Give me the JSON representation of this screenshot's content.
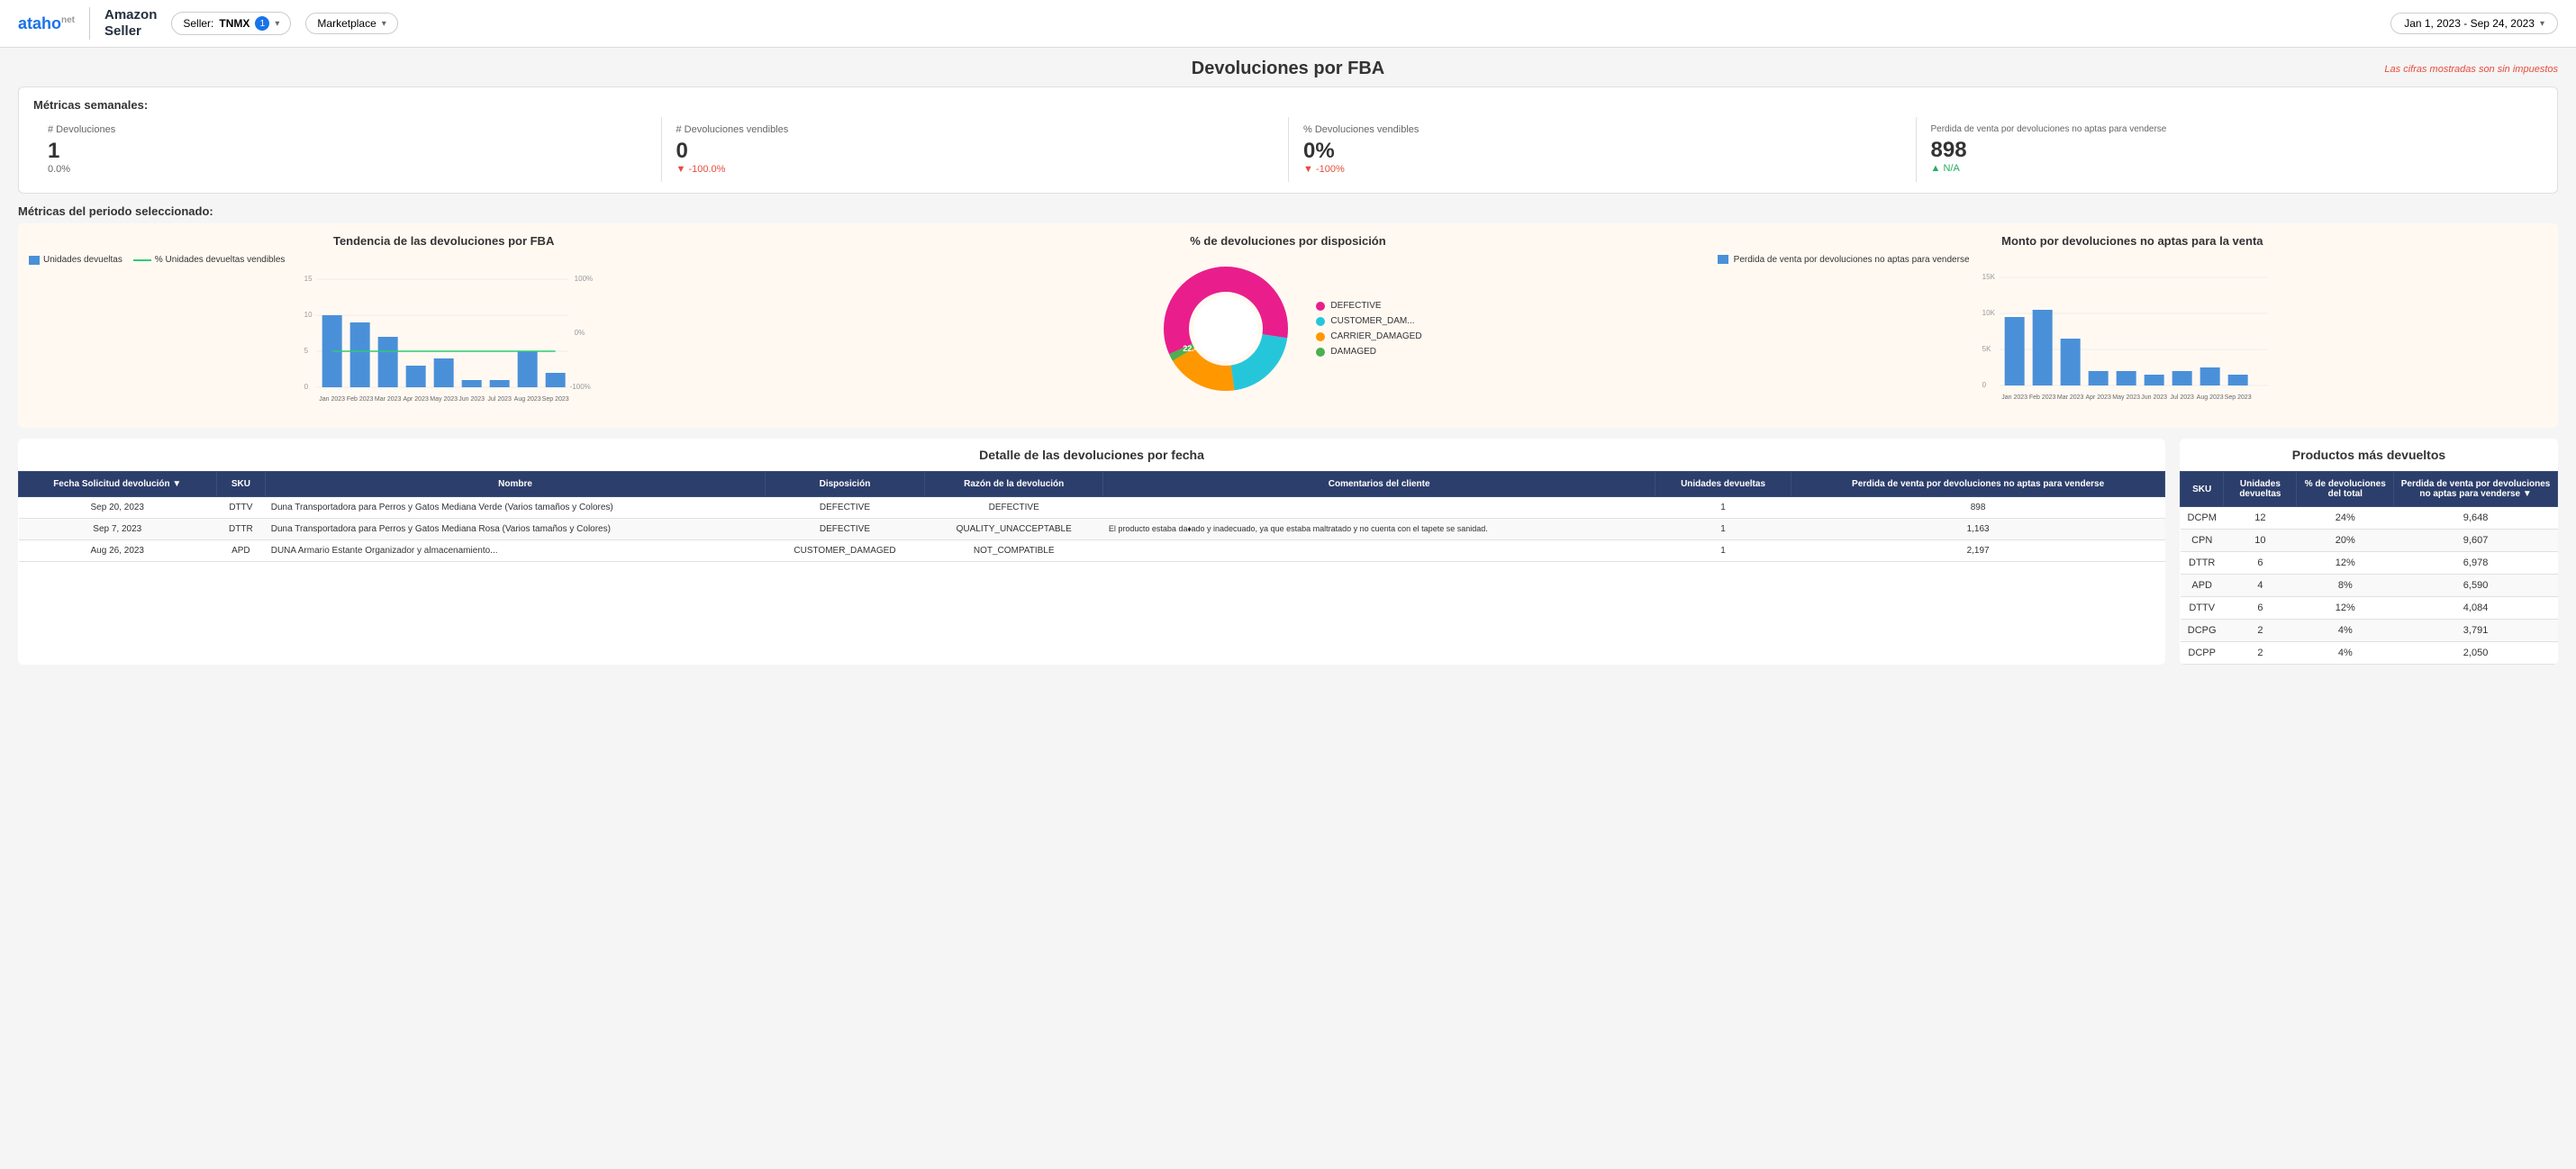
{
  "header": {
    "logo_main": "ataho",
    "logo_sup": "net",
    "brand_line1": "Amazon",
    "brand_line2": "Seller",
    "seller_label": "Seller:",
    "seller_value": "TNMX",
    "seller_count": "1",
    "marketplace_label": "Marketplace",
    "date_range": "Jan 1, 2023 - Sep 24, 2023"
  },
  "page": {
    "title": "Devoluciones por FBA",
    "tax_note": "Las cifras mostradas son sin impuestos"
  },
  "weekly_metrics": {
    "label": "Métricas semanales:",
    "items": [
      {
        "header": "# Devoluciones",
        "value": "1",
        "change": "0.0%",
        "change_type": "neutral"
      },
      {
        "header": "# Devoluciones vendibles",
        "value": "0",
        "change": "▼ -100.0%",
        "change_type": "down"
      },
      {
        "header": "% Devoluciones vendibles",
        "value": "0%",
        "change": "▼ -100%",
        "change_type": "down"
      },
      {
        "header": "Perdida de venta por devoluciones no aptas para venderse",
        "value": "898",
        "change": "▲ N/A",
        "change_type": "up"
      }
    ]
  },
  "period_metrics_label": "Métricas del periodo seleccionado:",
  "charts": {
    "trend": {
      "title": "Tendencia de las devoluciones por FBA",
      "legend_bar": "Unidades devueltas",
      "legend_line": "% Unidades devueltas vendibles",
      "months": [
        "Jan 2023",
        "Feb 2023",
        "Mar 2023",
        "Apr 2023",
        "May 2023",
        "Jun 2023",
        "Jul 2023",
        "Aug 2023",
        "Sep 2023"
      ],
      "values": [
        10,
        9,
        7,
        3,
        4,
        1,
        1,
        5,
        2
      ],
      "y_left_max": 15,
      "y_right_labels": [
        "100%",
        "0%",
        "-100%"
      ]
    },
    "disposition": {
      "title": "% de devoluciones por disposición",
      "segments": [
        {
          "label": "DEFECTIVE",
          "value": 55.1,
          "color": "#e91e8c"
        },
        {
          "label": "CUSTOMER_DAM...",
          "value": 22.4,
          "color": "#26c6da"
        },
        {
          "label": "CARRIER_DAMAGED",
          "value": 20.4,
          "color": "#ff9800"
        },
        {
          "label": "DAMAGED",
          "value": 2.1,
          "color": "#4caf50"
        }
      ]
    },
    "sales_loss": {
      "title": "Monto por devoluciones no aptas para la venta",
      "legend": "Perdida de venta por devoluciones no aptas para venderse",
      "months": [
        "Jan 2023",
        "Feb 2023",
        "Mar 2023",
        "Apr 2023",
        "May 2023",
        "Jun 2023",
        "Jul 2023",
        "Aug 2023",
        "Sep 2023"
      ],
      "values": [
        9500,
        10500,
        6500,
        2000,
        2000,
        1500,
        2000,
        2500,
        1500
      ],
      "y_labels": [
        "15K",
        "10K",
        "5K",
        "0"
      ]
    }
  },
  "returns_table": {
    "title": "Detalle de las devoluciones por fecha",
    "columns": [
      "Fecha Solicitud devolución ▼",
      "SKU",
      "Nombre",
      "Disposición",
      "Razón de la devolución",
      "Comentarios del cliente",
      "Unidades devueltas",
      "Perdida de venta por devoluciones no aptas para venderse"
    ],
    "rows": [
      {
        "fecha": "Sep 20, 2023",
        "sku": "DTTV",
        "nombre": "Duna Transportadora para Perros y Gatos Mediana Verde (Varios tamaños y Colores)",
        "disposicion": "DEFECTIVE",
        "razon": "DEFECTIVE",
        "comentarios": "",
        "unidades": "1",
        "perdida": "898"
      },
      {
        "fecha": "Sep 7, 2023",
        "sku": "DTTR",
        "nombre": "Duna Transportadora para Perros y Gatos Mediana Rosa (Varios tamaños y Colores)",
        "disposicion": "DEFECTIVE",
        "razon": "QUALITY_UNACCEPTABLE",
        "comentarios": "El producto estaba da⬧ado y inadecuado, ya que estaba maltratado y no cuenta con el tapete se sanidad.",
        "unidades": "1",
        "perdida": "1,163"
      },
      {
        "fecha": "Aug 26, 2023",
        "sku": "APD",
        "nombre": "DUNA Armario Estante Organizador y almacenamiento...",
        "disposicion": "CUSTOMER_DAMAGED",
        "razon": "NOT_COMPATIBLE",
        "comentarios": "",
        "unidades": "1",
        "perdida": "2,197"
      }
    ]
  },
  "products_table": {
    "title": "Productos más devueltos",
    "columns": [
      "SKU",
      "Unidades devueltas",
      "% de devoluciones del total",
      "Perdida de venta por devoluciones no aptas para venderse ▼"
    ],
    "rows": [
      {
        "sku": "DCPM",
        "unidades": "12",
        "pct": "24%",
        "perdida": "9,648"
      },
      {
        "sku": "CPN",
        "unidades": "10",
        "pct": "20%",
        "perdida": "9,607"
      },
      {
        "sku": "DTTR",
        "unidades": "6",
        "pct": "12%",
        "perdida": "6,978"
      },
      {
        "sku": "APD",
        "unidades": "4",
        "pct": "8%",
        "perdida": "6,590"
      },
      {
        "sku": "DTTV",
        "unidades": "6",
        "pct": "12%",
        "perdida": "4,084"
      },
      {
        "sku": "DCPG",
        "unidades": "2",
        "pct": "4%",
        "perdida": "3,791"
      },
      {
        "sku": "DCPP",
        "unidades": "2",
        "pct": "4%",
        "perdida": "2,050"
      }
    ]
  }
}
